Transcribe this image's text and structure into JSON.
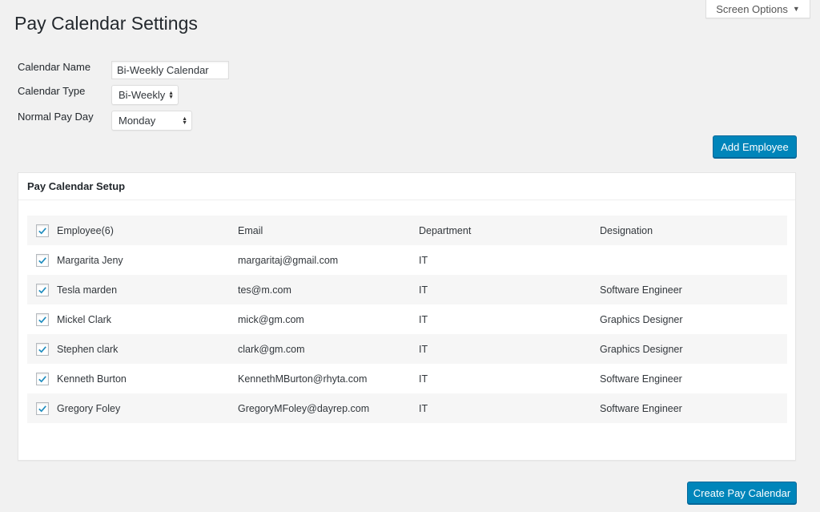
{
  "screen_options": {
    "label": "Screen Options",
    "caret": "▼"
  },
  "page_title": "Pay Calendar Settings",
  "form": {
    "calendar_name_label": "Calendar Name",
    "calendar_name_value": "Bi-Weekly Calendar",
    "calendar_type_label": "Calendar Type",
    "calendar_type_value": "Bi-Weekly",
    "normal_pay_day_label": "Normal Pay Day",
    "normal_pay_day_value": "Monday"
  },
  "add_employee_label": "Add Employee",
  "panel": {
    "title": "Pay Calendar Setup",
    "columns": [
      "Employee(6)",
      "Email",
      "Department",
      "Designation"
    ],
    "rows": [
      {
        "name": "Margarita Jeny",
        "email": "margaritaj@gmail.com",
        "department": "IT",
        "designation": ""
      },
      {
        "name": "Tesla marden",
        "email": "tes@m.com",
        "department": "IT",
        "designation": "Software Engineer"
      },
      {
        "name": "Mickel Clark",
        "email": "mick@gm.com",
        "department": "IT",
        "designation": "Graphics Designer"
      },
      {
        "name": "Stephen clark",
        "email": "clark@gm.com",
        "department": "IT",
        "designation": "Graphics Designer"
      },
      {
        "name": "Kenneth Burton",
        "email": "KennethMBurton@rhyta.com",
        "department": "IT",
        "designation": "Software Engineer"
      },
      {
        "name": "Gregory Foley",
        "email": "GregoryMFoley@dayrep.com",
        "department": "IT",
        "designation": "Software Engineer"
      }
    ]
  },
  "create_pay_calendar_label": "Create Pay Calendar",
  "colors": {
    "primary": "#0085ba",
    "check": "#1e8cbe",
    "background": "#f1f1f1"
  }
}
